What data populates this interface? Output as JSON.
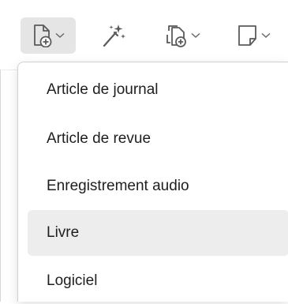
{
  "toolbar": {
    "buttons": [
      {
        "icon": "new-item-icon",
        "has_dropdown": true,
        "active": true
      },
      {
        "icon": "magic-wand-icon",
        "has_dropdown": false,
        "active": false
      },
      {
        "icon": "new-attachment-icon",
        "has_dropdown": true,
        "active": false
      },
      {
        "icon": "new-note-icon",
        "has_dropdown": true,
        "active": false
      }
    ]
  },
  "menu": {
    "items": [
      {
        "label": "Article de journal"
      },
      {
        "label": "Article de revue"
      },
      {
        "label": "Enregistrement audio"
      },
      {
        "label": "Livre",
        "highlighted": true
      },
      {
        "label": "Logiciel"
      }
    ]
  },
  "colors": {
    "hover_background": "#ededed",
    "active_button_background": "#e5e5e5",
    "icon_color": "#5a5a5a",
    "text_color": "#1e1e1e"
  }
}
